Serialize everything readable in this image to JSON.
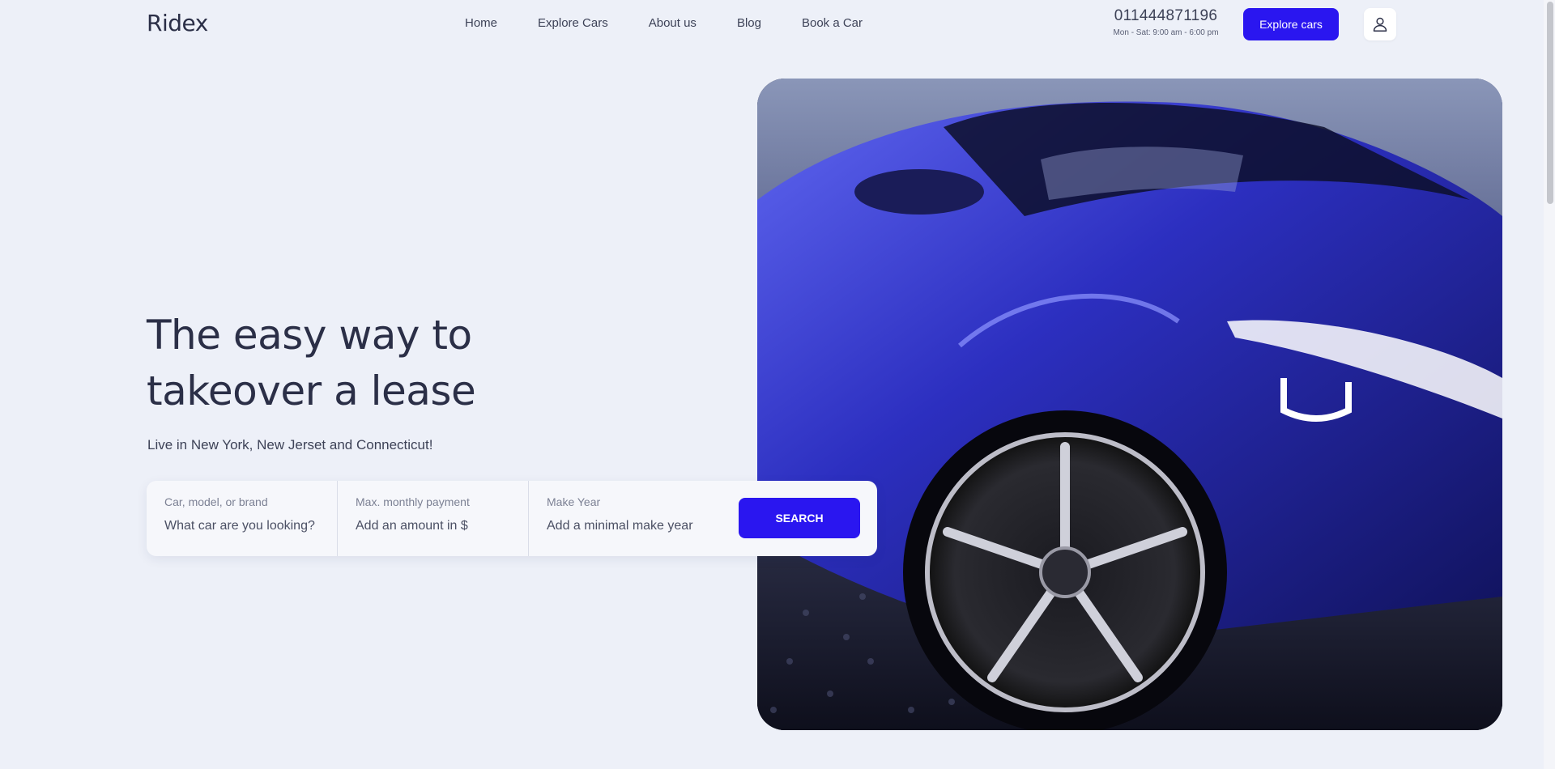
{
  "brand": {
    "name": "Ridex"
  },
  "nav": {
    "items": [
      {
        "label": "Home"
      },
      {
        "label": "Explore Cars"
      },
      {
        "label": "About us"
      },
      {
        "label": "Blog"
      },
      {
        "label": "Book a Car"
      }
    ]
  },
  "contact": {
    "phone": "011444871196",
    "hours": "Mon - Sat: 9:00 am - 6:00 pm"
  },
  "header": {
    "explore_button": "Explore cars",
    "user_icon": "user-icon"
  },
  "hero": {
    "title_line1": "The easy way to",
    "title_line2": "takeover a lease",
    "subtitle": "Live in New York, New Jerset and Connecticut!"
  },
  "search": {
    "fields": [
      {
        "label": "Car, model, or brand",
        "placeholder": "What car are you looking?"
      },
      {
        "label": "Max. monthly payment",
        "placeholder": "Add an amount in $"
      },
      {
        "label": "Make Year",
        "placeholder": "Add a minimal make year"
      }
    ],
    "button": "SEARCH"
  },
  "colors": {
    "accent": "#2a16f0",
    "background": "#edf0f8",
    "text": "#2b2f47"
  }
}
